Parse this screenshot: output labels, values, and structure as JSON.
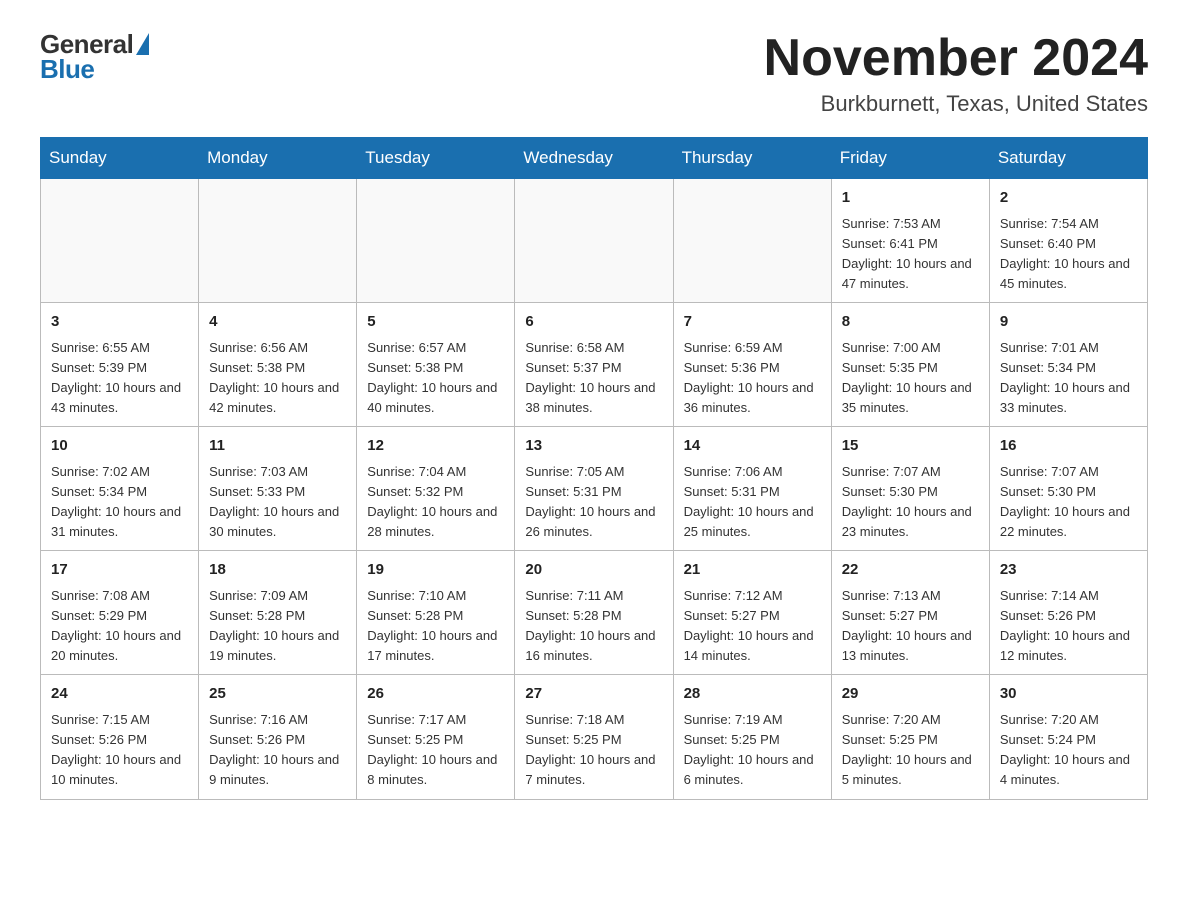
{
  "header": {
    "logo_general": "General",
    "logo_blue": "Blue",
    "month_title": "November 2024",
    "location": "Burkburnett, Texas, United States"
  },
  "weekdays": [
    "Sunday",
    "Monday",
    "Tuesday",
    "Wednesday",
    "Thursday",
    "Friday",
    "Saturday"
  ],
  "weeks": [
    [
      {
        "day": "",
        "sunrise": "",
        "sunset": "",
        "daylight": ""
      },
      {
        "day": "",
        "sunrise": "",
        "sunset": "",
        "daylight": ""
      },
      {
        "day": "",
        "sunrise": "",
        "sunset": "",
        "daylight": ""
      },
      {
        "day": "",
        "sunrise": "",
        "sunset": "",
        "daylight": ""
      },
      {
        "day": "",
        "sunrise": "",
        "sunset": "",
        "daylight": ""
      },
      {
        "day": "1",
        "sunrise": "Sunrise: 7:53 AM",
        "sunset": "Sunset: 6:41 PM",
        "daylight": "Daylight: 10 hours and 47 minutes."
      },
      {
        "day": "2",
        "sunrise": "Sunrise: 7:54 AM",
        "sunset": "Sunset: 6:40 PM",
        "daylight": "Daylight: 10 hours and 45 minutes."
      }
    ],
    [
      {
        "day": "3",
        "sunrise": "Sunrise: 6:55 AM",
        "sunset": "Sunset: 5:39 PM",
        "daylight": "Daylight: 10 hours and 43 minutes."
      },
      {
        "day": "4",
        "sunrise": "Sunrise: 6:56 AM",
        "sunset": "Sunset: 5:38 PM",
        "daylight": "Daylight: 10 hours and 42 minutes."
      },
      {
        "day": "5",
        "sunrise": "Sunrise: 6:57 AM",
        "sunset": "Sunset: 5:38 PM",
        "daylight": "Daylight: 10 hours and 40 minutes."
      },
      {
        "day": "6",
        "sunrise": "Sunrise: 6:58 AM",
        "sunset": "Sunset: 5:37 PM",
        "daylight": "Daylight: 10 hours and 38 minutes."
      },
      {
        "day": "7",
        "sunrise": "Sunrise: 6:59 AM",
        "sunset": "Sunset: 5:36 PM",
        "daylight": "Daylight: 10 hours and 36 minutes."
      },
      {
        "day": "8",
        "sunrise": "Sunrise: 7:00 AM",
        "sunset": "Sunset: 5:35 PM",
        "daylight": "Daylight: 10 hours and 35 minutes."
      },
      {
        "day": "9",
        "sunrise": "Sunrise: 7:01 AM",
        "sunset": "Sunset: 5:34 PM",
        "daylight": "Daylight: 10 hours and 33 minutes."
      }
    ],
    [
      {
        "day": "10",
        "sunrise": "Sunrise: 7:02 AM",
        "sunset": "Sunset: 5:34 PM",
        "daylight": "Daylight: 10 hours and 31 minutes."
      },
      {
        "day": "11",
        "sunrise": "Sunrise: 7:03 AM",
        "sunset": "Sunset: 5:33 PM",
        "daylight": "Daylight: 10 hours and 30 minutes."
      },
      {
        "day": "12",
        "sunrise": "Sunrise: 7:04 AM",
        "sunset": "Sunset: 5:32 PM",
        "daylight": "Daylight: 10 hours and 28 minutes."
      },
      {
        "day": "13",
        "sunrise": "Sunrise: 7:05 AM",
        "sunset": "Sunset: 5:31 PM",
        "daylight": "Daylight: 10 hours and 26 minutes."
      },
      {
        "day": "14",
        "sunrise": "Sunrise: 7:06 AM",
        "sunset": "Sunset: 5:31 PM",
        "daylight": "Daylight: 10 hours and 25 minutes."
      },
      {
        "day": "15",
        "sunrise": "Sunrise: 7:07 AM",
        "sunset": "Sunset: 5:30 PM",
        "daylight": "Daylight: 10 hours and 23 minutes."
      },
      {
        "day": "16",
        "sunrise": "Sunrise: 7:07 AM",
        "sunset": "Sunset: 5:30 PM",
        "daylight": "Daylight: 10 hours and 22 minutes."
      }
    ],
    [
      {
        "day": "17",
        "sunrise": "Sunrise: 7:08 AM",
        "sunset": "Sunset: 5:29 PM",
        "daylight": "Daylight: 10 hours and 20 minutes."
      },
      {
        "day": "18",
        "sunrise": "Sunrise: 7:09 AM",
        "sunset": "Sunset: 5:28 PM",
        "daylight": "Daylight: 10 hours and 19 minutes."
      },
      {
        "day": "19",
        "sunrise": "Sunrise: 7:10 AM",
        "sunset": "Sunset: 5:28 PM",
        "daylight": "Daylight: 10 hours and 17 minutes."
      },
      {
        "day": "20",
        "sunrise": "Sunrise: 7:11 AM",
        "sunset": "Sunset: 5:28 PM",
        "daylight": "Daylight: 10 hours and 16 minutes."
      },
      {
        "day": "21",
        "sunrise": "Sunrise: 7:12 AM",
        "sunset": "Sunset: 5:27 PM",
        "daylight": "Daylight: 10 hours and 14 minutes."
      },
      {
        "day": "22",
        "sunrise": "Sunrise: 7:13 AM",
        "sunset": "Sunset: 5:27 PM",
        "daylight": "Daylight: 10 hours and 13 minutes."
      },
      {
        "day": "23",
        "sunrise": "Sunrise: 7:14 AM",
        "sunset": "Sunset: 5:26 PM",
        "daylight": "Daylight: 10 hours and 12 minutes."
      }
    ],
    [
      {
        "day": "24",
        "sunrise": "Sunrise: 7:15 AM",
        "sunset": "Sunset: 5:26 PM",
        "daylight": "Daylight: 10 hours and 10 minutes."
      },
      {
        "day": "25",
        "sunrise": "Sunrise: 7:16 AM",
        "sunset": "Sunset: 5:26 PM",
        "daylight": "Daylight: 10 hours and 9 minutes."
      },
      {
        "day": "26",
        "sunrise": "Sunrise: 7:17 AM",
        "sunset": "Sunset: 5:25 PM",
        "daylight": "Daylight: 10 hours and 8 minutes."
      },
      {
        "day": "27",
        "sunrise": "Sunrise: 7:18 AM",
        "sunset": "Sunset: 5:25 PM",
        "daylight": "Daylight: 10 hours and 7 minutes."
      },
      {
        "day": "28",
        "sunrise": "Sunrise: 7:19 AM",
        "sunset": "Sunset: 5:25 PM",
        "daylight": "Daylight: 10 hours and 6 minutes."
      },
      {
        "day": "29",
        "sunrise": "Sunrise: 7:20 AM",
        "sunset": "Sunset: 5:25 PM",
        "daylight": "Daylight: 10 hours and 5 minutes."
      },
      {
        "day": "30",
        "sunrise": "Sunrise: 7:20 AM",
        "sunset": "Sunset: 5:24 PM",
        "daylight": "Daylight: 10 hours and 4 minutes."
      }
    ]
  ]
}
